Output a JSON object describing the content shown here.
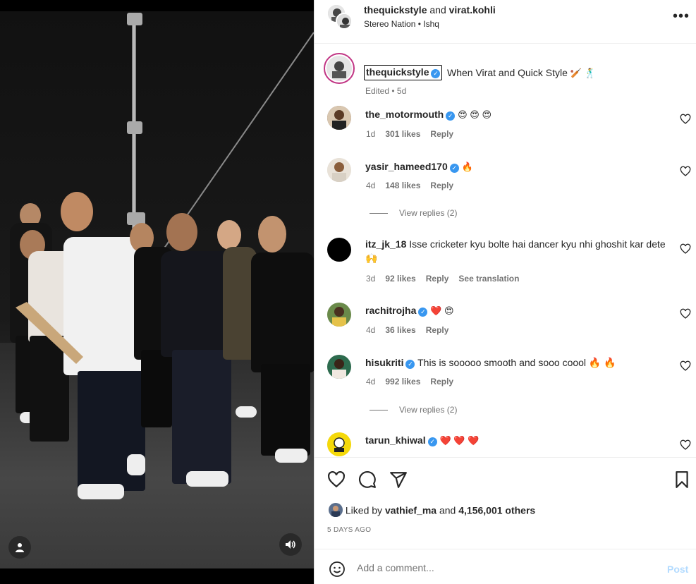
{
  "post": {
    "author": "thequickstyle",
    "collaborator": "virat.kohli",
    "joiner": "and",
    "music": "Stereo Nation • Ishq",
    "caption": "When Virat and Quick Style",
    "caption_emoji": "🏏 🕺",
    "edited": "Edited • 5d"
  },
  "comments": [
    {
      "user": "the_motormouth",
      "verified": true,
      "text": "😍 😍 😍",
      "time": "1d",
      "likes": "301 likes",
      "reply": "Reply",
      "translate": ""
    },
    {
      "user": "yasir_hameed170",
      "verified": true,
      "text": "🔥",
      "time": "4d",
      "likes": "148 likes",
      "reply": "Reply",
      "translate": "",
      "view_replies": "View replies (2)"
    },
    {
      "user": "itz_jk_18",
      "verified": false,
      "text": "Isse cricketer kyu bolte hai dancer kyu nhi ghoshit kar dete 🙌",
      "time": "3d",
      "likes": "92 likes",
      "reply": "Reply",
      "translate": "See translation"
    },
    {
      "user": "rachitrojha",
      "verified": true,
      "text": "❤️ 😍",
      "time": "4d",
      "likes": "36 likes",
      "reply": "Reply",
      "translate": ""
    },
    {
      "user": "hisukriti",
      "verified": true,
      "text": "This is sooooo smooth and sooo coool 🔥 🔥",
      "time": "4d",
      "likes": "992 likes",
      "reply": "Reply",
      "translate": "",
      "view_replies": "View replies (2)"
    },
    {
      "user": "tarun_khiwal",
      "verified": true,
      "text": "❤️ ❤️ ❤️",
      "time": "",
      "likes": "",
      "reply": "",
      "translate": ""
    }
  ],
  "likes": {
    "prefix": "Liked by",
    "user": "vathief_ma",
    "middle": "and",
    "others": "4,156,001 others"
  },
  "date": "5 DAYS AGO",
  "add_comment": {
    "placeholder": "Add a comment...",
    "post_label": "Post"
  },
  "colors": {
    "verified": "#3897f0",
    "post_disabled": "#b3dbff",
    "media_bg": "#000000"
  },
  "icons": [
    "user-tag-icon",
    "sound-icon",
    "more-icon",
    "heart-icon",
    "comment-icon",
    "share-icon",
    "bookmark-icon",
    "emoji-icon",
    "verified-icon"
  ]
}
